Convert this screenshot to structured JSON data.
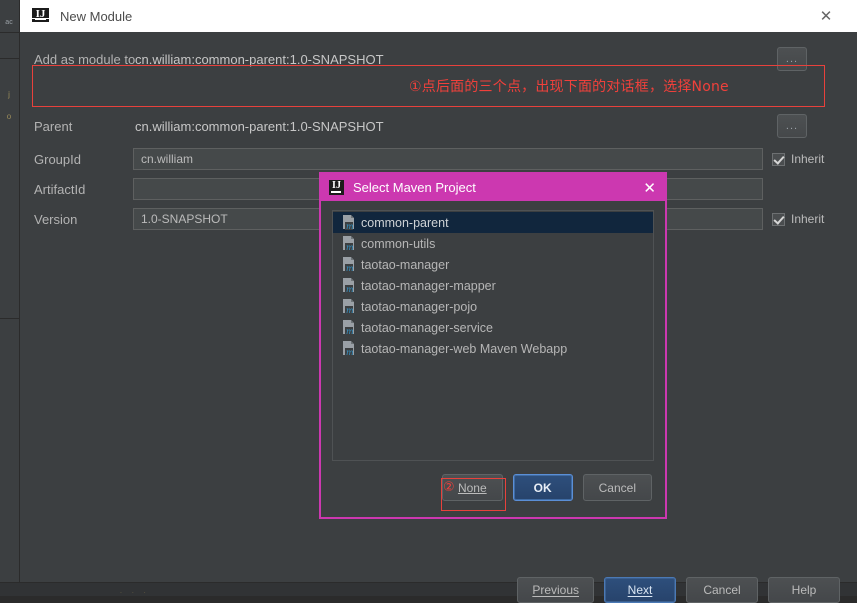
{
  "window": {
    "title": "New Module",
    "logo_text": "IJ",
    "close_icon": "✕"
  },
  "form": {
    "add_as_module": {
      "label": "Add as module to",
      "value": "cn.william:common-parent:1.0-SNAPSHOT",
      "browse_label": "..."
    },
    "parent": {
      "label": "Parent",
      "value": "cn.william:common-parent:1.0-SNAPSHOT",
      "browse_label": "..."
    },
    "groupid": {
      "label": "GroupId",
      "value": "cn.william",
      "inherit_label": "Inherit",
      "inherit_checked": true
    },
    "artifactid": {
      "label": "ArtifactId",
      "value": ""
    },
    "version": {
      "label": "Version",
      "value": "1.0-SNAPSHOT",
      "inherit_label": "Inherit",
      "inherit_checked": true
    }
  },
  "annotations": {
    "step1_text": "①点后面的三个点，出现下面的对话框，选择None",
    "step2_marker": "②",
    "color": "#f0403b"
  },
  "wizard_buttons": {
    "previous": "Previous",
    "next": "Next",
    "cancel": "Cancel",
    "help": "Help"
  },
  "maven_dialog": {
    "title": "Select Maven Project",
    "logo_text": "IJ",
    "close_icon": "✕",
    "projects": [
      {
        "name": "common-parent",
        "selected": true
      },
      {
        "name": "common-utils",
        "selected": false
      },
      {
        "name": "taotao-manager",
        "selected": false
      },
      {
        "name": "taotao-manager-mapper",
        "selected": false
      },
      {
        "name": "taotao-manager-pojo",
        "selected": false
      },
      {
        "name": "taotao-manager-service",
        "selected": false
      },
      {
        "name": "taotao-manager-web Maven Webapp",
        "selected": false
      }
    ],
    "buttons": {
      "none": "None",
      "ok": "OK",
      "cancel": "Cancel"
    },
    "accent_color": "#cc38b0",
    "selection_color": "#11263d"
  }
}
